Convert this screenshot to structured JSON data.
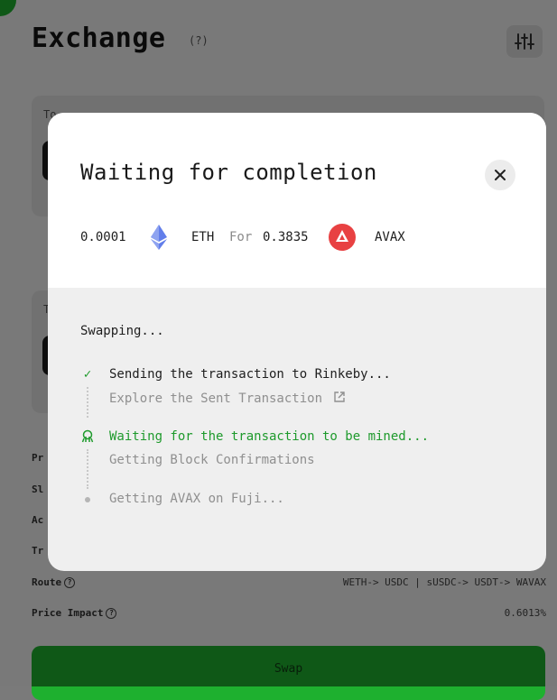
{
  "page": {
    "title": "Exchange",
    "help": "(?)",
    "card1_label": "To",
    "card2_label": "T",
    "rows": [
      {
        "label": "Pr",
        "value": ""
      },
      {
        "label": "Sl",
        "value": ""
      },
      {
        "label": "Ac",
        "value": ""
      },
      {
        "label": "Tr",
        "value": ""
      },
      {
        "label": "Route",
        "value": "WETH-> USDC | sUSDC-> USDT-> WAVAX"
      },
      {
        "label": "Price Impact",
        "value": "0.6013%"
      }
    ],
    "swap_label": "Swap",
    "accent": "#1eb02f"
  },
  "modal": {
    "title": "Waiting for completion",
    "from_amount": "0.0001",
    "from_symbol": "ETH",
    "for_text": "For",
    "to_amount": "0.3835",
    "to_symbol": "AVAX",
    "status": "Swapping...",
    "steps": [
      {
        "text": "Sending the transaction to Rinkeby...",
        "state": "done",
        "icon": "check-icon"
      },
      {
        "text": "Explore the Sent Transaction",
        "state": "pending",
        "icon": "external-link-icon"
      },
      {
        "text": "Waiting for the transaction to be mined...",
        "state": "active",
        "icon": "spinner-icon"
      },
      {
        "text": "Getting Block Confirmations",
        "state": "pending",
        "icon": ""
      },
      {
        "text": "Getting AVAX on Fuji...",
        "state": "pending",
        "icon": "dot-icon"
      }
    ],
    "colors": {
      "active": "#1e9a2c",
      "avax": "#e84142",
      "eth": "#627eea"
    }
  }
}
